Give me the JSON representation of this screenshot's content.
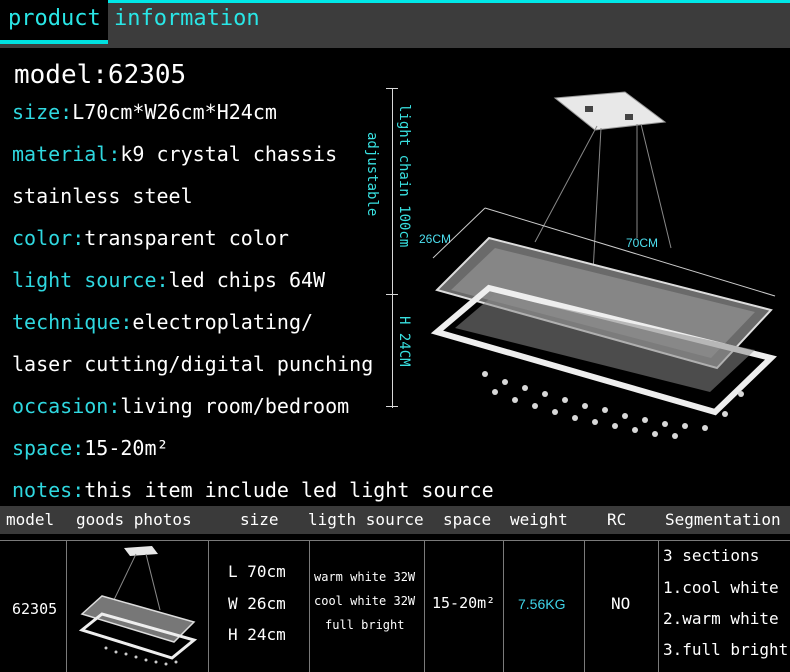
{
  "header": {
    "title": "product information"
  },
  "model_line": "model:62305",
  "specs": [
    {
      "key": "size:",
      "value": "L70cm*W26cm*H24cm"
    },
    {
      "key": "material:",
      "value": "k9 crystal chassis"
    },
    {
      "key": "",
      "value": "stainless steel"
    },
    {
      "key": "color:",
      "value": "transparent color"
    },
    {
      "key": "light source:",
      "value": "led chips 64W"
    },
    {
      "key": "technique:",
      "value": "electroplating/"
    },
    {
      "key": "",
      "value": "laser cutting/digital punching"
    },
    {
      "key": "occasion:",
      "value": "living room/bedroom"
    },
    {
      "key": "space:",
      "value": "15-20m²"
    },
    {
      "key": "notes:",
      "value": "this item include led light source"
    }
  ],
  "annotations": {
    "chain": "light chain 100cm",
    "adjustable": "adjustable",
    "height": "H 24CM",
    "depth": "26CM",
    "width": "70CM"
  },
  "table": {
    "headers": [
      "model",
      "goods photos",
      "size",
      "ligth source",
      "space",
      "weight",
      "RC",
      "Segmentation"
    ],
    "row": {
      "model": "62305",
      "size": [
        "L 70cm",
        "W 26cm",
        "H 24cm"
      ],
      "light_source": [
        "warm white 32W",
        "cool white 32W",
        "full bright"
      ],
      "space": "15-20m²",
      "weight": "7.56KG",
      "rc": "NO",
      "segmentation": [
        "3 sections",
        "1.cool white",
        "2.warm white",
        "3.full bright"
      ]
    }
  },
  "colors": {
    "accent": "#2fd8e0",
    "header_bg": "#3c3c3c",
    "background": "#000000"
  }
}
